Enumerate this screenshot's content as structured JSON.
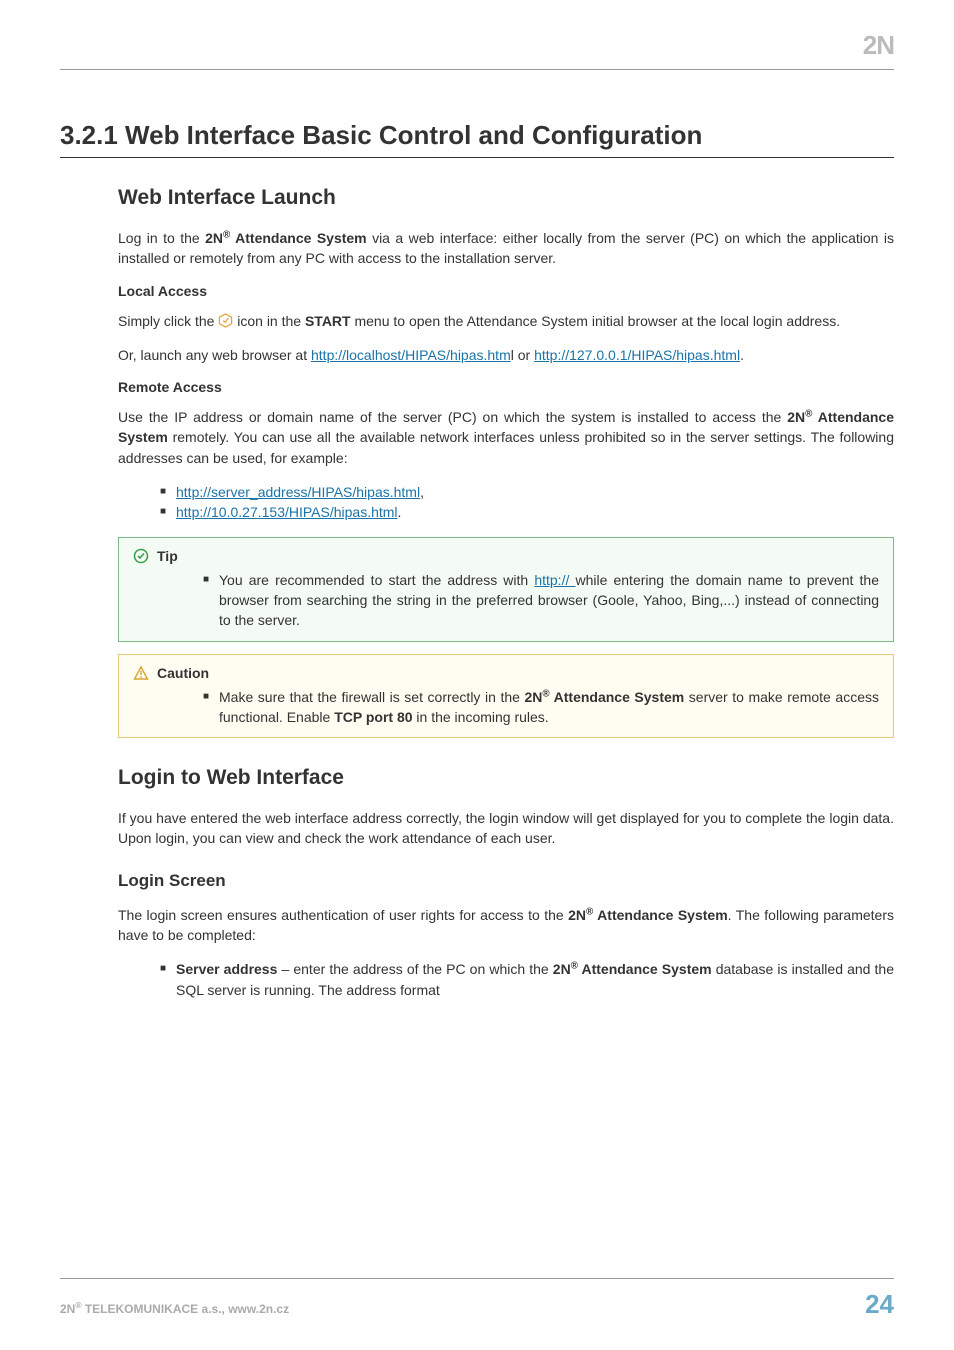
{
  "header": {
    "logo_text": "2N"
  },
  "section": {
    "heading": "3.2.1 Web Interface Basic Control and Configuration",
    "h2_launch": "Web Interface Launch",
    "p_login_intro_a": "Log in to the ",
    "p_login_intro_brand_pre": "2N",
    "p_login_intro_brand_reg": "®",
    "p_login_intro_brand_post": " Attendance System",
    "p_login_intro_b": " via a web interface: either locally from the server (PC) on which the application is installed or remotely from any PC with access to the installation server.",
    "local_access_label": "Local Access",
    "p_local_a": "Simply click the ",
    "p_local_b": " icon in the ",
    "p_local_start": "START",
    "p_local_c": " menu to open the Attendance System initial browser at the local login address.",
    "p_or_a": "Or, launch any web browser at ",
    "link_localhost": "http://localhost/HIPAS/hipas.htm",
    "p_or_l": "l",
    "p_or_or": " or ",
    "link_127": "http://127.0.0.1/HIPAS/hipas.html",
    "p_or_period": ".",
    "remote_access_label": "Remote Access",
    "p_remote_a": "Use the IP address or domain name of the server (PC) on which the system is installed to access the ",
    "p_remote_b": " remotely. You can use all the available network interfaces unless prohibited so in the server settings. The following addresses can be used, for example:",
    "links": {
      "server_address": "http://server_address/HIPAS/hipas.html",
      "ip_example": "http://10.0.27.153/HIPAS/hipas.html"
    },
    "tip": {
      "title": "Tip",
      "text_a": "You are recommended to start the address with ",
      "text_link": " http:// ",
      "text_b": "while entering the domain name to prevent the browser from searching the string in the preferred browser (Goole, Yahoo, Bing,...) instead of connecting to the server."
    },
    "caution": {
      "title": "Caution",
      "text_a": "Make sure that the firewall is set correctly in the ",
      "text_b": " server to make remote access functional. Enable ",
      "tcp": "TCP port 80",
      "text_c": " in the incoming rules."
    },
    "h2_login": "Login to Web Interface",
    "p_login_intro2": "If you have entered the web interface address correctly, the login window will get displayed for you to complete the login data. Upon login, you can view and check the work attendance of each user.",
    "h3_login_screen": "Login Screen",
    "p_login_screen_a": "The login screen ensures authentication of user rights for access to the ",
    "p_login_screen_b": ". The following parameters have to be completed:",
    "server_addr_label": "Server address",
    "server_addr_text_a": " – enter the address of the PC on which the ",
    "server_addr_text_b": " database is installed and the SQL server is running. The address format"
  },
  "footer": {
    "left_pre": "2N",
    "left_reg": "®",
    "left_rest": " TELEKOMUNIKACE a.s., www.2n.cz",
    "page": "24"
  }
}
